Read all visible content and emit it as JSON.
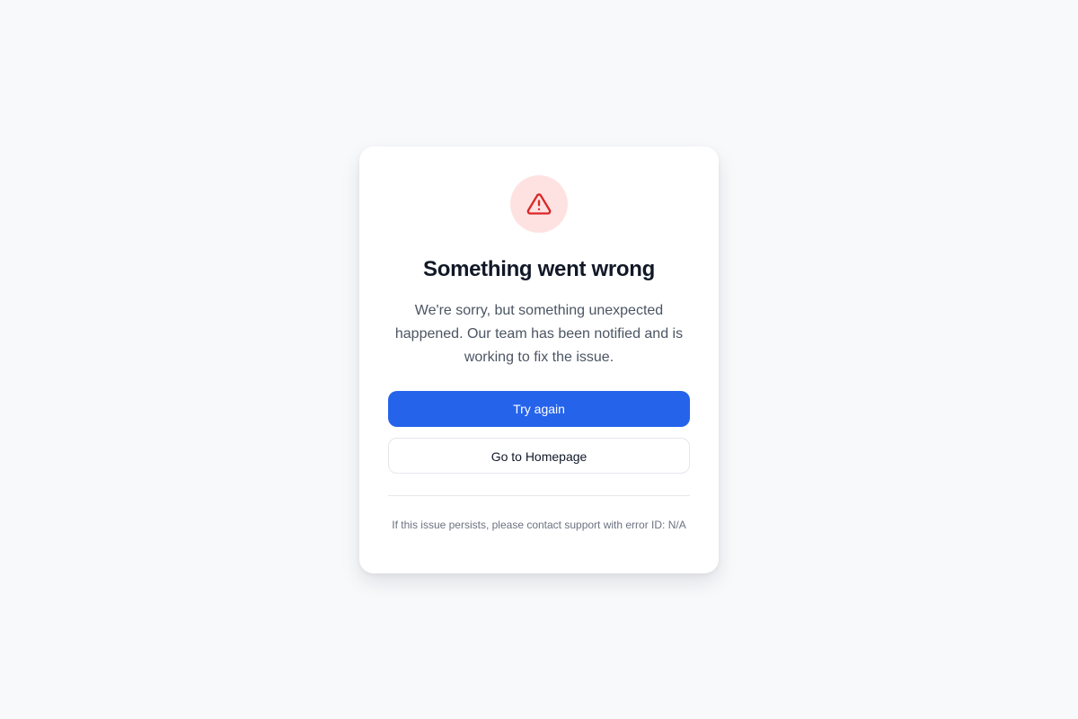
{
  "error": {
    "title": "Something went wrong",
    "message": "We're sorry, but something unexpected happened. Our team has been notified and is working to fix the issue.",
    "icon": "warning-triangle-icon"
  },
  "actions": {
    "retry_label": "Try again",
    "home_label": "Go to Homepage"
  },
  "footer": {
    "support_text": "If this issue persists, please contact support with error ID: N/A"
  },
  "colors": {
    "background": "#f8f9fb",
    "primary": "#2563eb",
    "danger": "#dc2626",
    "danger_soft": "#fee2e2"
  }
}
